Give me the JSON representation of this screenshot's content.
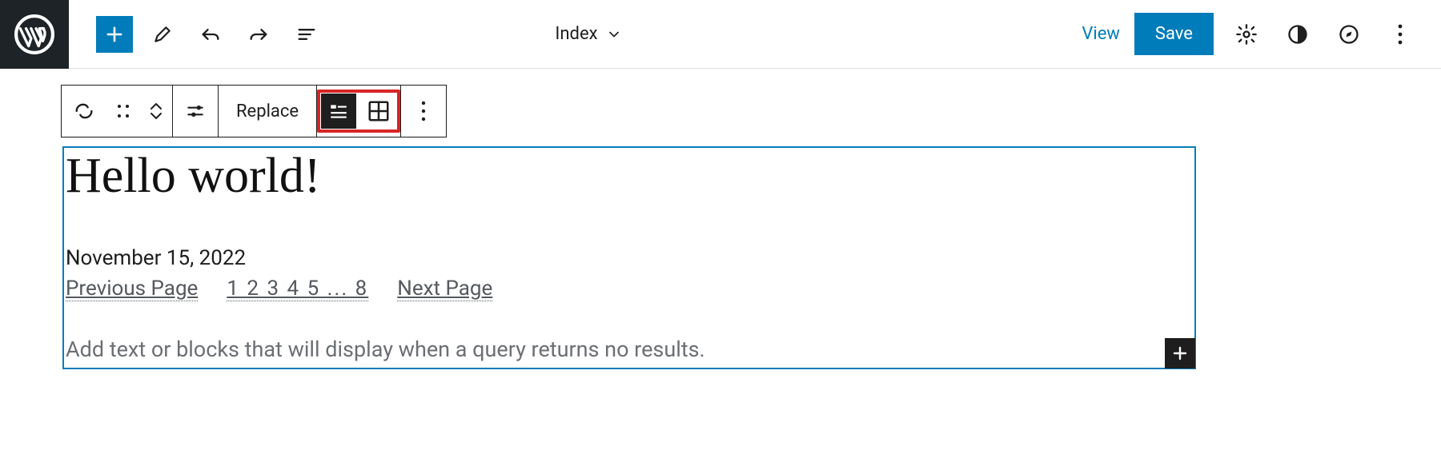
{
  "header": {
    "document_label": "Index",
    "view_label": "View",
    "save_label": "Save"
  },
  "block_toolbar": {
    "replace_label": "Replace"
  },
  "query": {
    "post_title": "Hello world!",
    "post_date": "November 15, 2022",
    "prev_label": "Previous Page",
    "next_label": "Next Page",
    "page_numbers": "1 2 3 4 5 ... 8",
    "no_results_text": "Add text or blocks that will display when a query returns no results."
  }
}
